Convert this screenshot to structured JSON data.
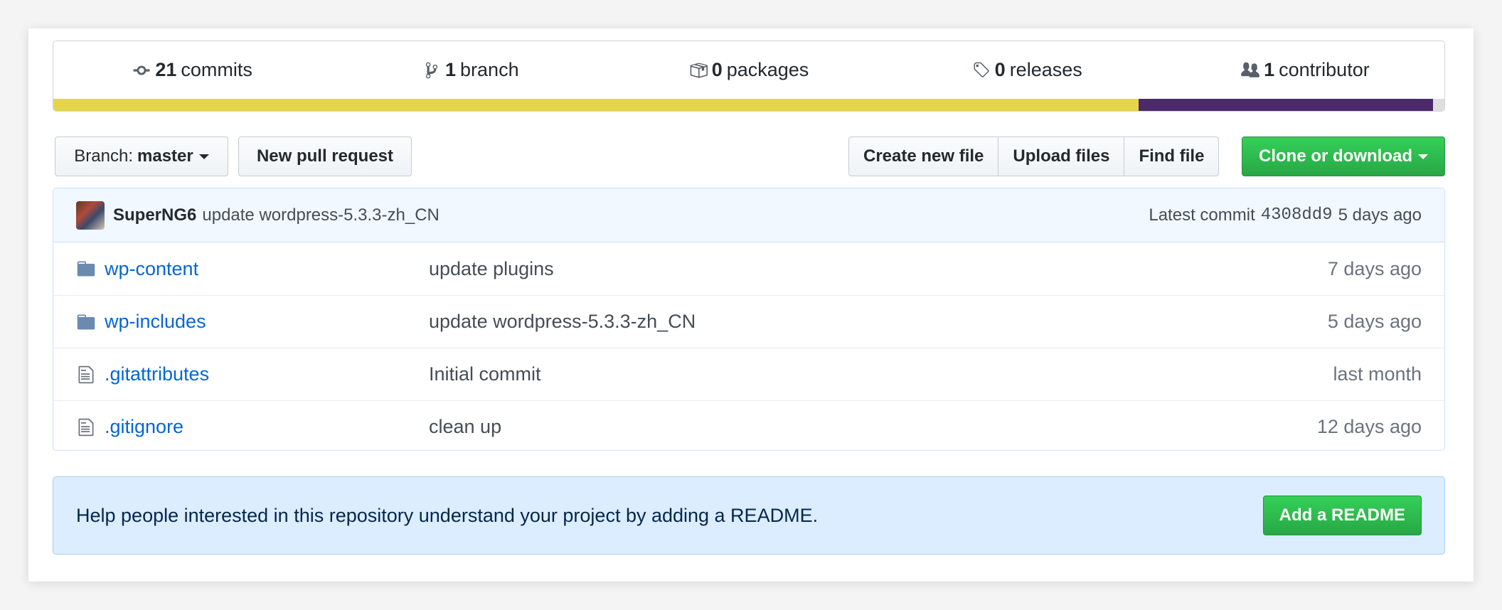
{
  "summary": {
    "commits": {
      "count": "21",
      "label": "commits",
      "icon": "history-icon"
    },
    "branches": {
      "count": "1",
      "label": "branch",
      "icon": "branch-icon"
    },
    "packages": {
      "count": "0",
      "label": "packages",
      "icon": "package-icon"
    },
    "releases": {
      "count": "0",
      "label": "releases",
      "icon": "tag-icon"
    },
    "contributors": {
      "count": "1",
      "label": "contributor",
      "icon": "people-icon"
    }
  },
  "language_bar": {
    "segments": [
      {
        "color": "#e6d54a",
        "fraction": 0.78
      },
      {
        "color": "#4b2a6b",
        "fraction": 0.212
      },
      {
        "color": "#dedede",
        "fraction": 0.008
      }
    ]
  },
  "toolbar": {
    "branch_prefix": "Branch:",
    "branch_name": "master",
    "new_pull_request": "New pull request",
    "create_new_file": "Create new file",
    "upload_files": "Upload files",
    "find_file": "Find file",
    "clone_or_download": "Clone or download"
  },
  "latest_commit": {
    "author": "SuperNG6",
    "message": "update wordpress-5.3.3-zh_CN",
    "label": "Latest commit",
    "sha": "4308dd9",
    "age": "5 days ago"
  },
  "files": [
    {
      "name": "wp-content",
      "type": "folder",
      "message": "update plugins",
      "age": "7 days ago"
    },
    {
      "name": "wp-includes",
      "type": "folder",
      "message": "update wordpress-5.3.3-zh_CN",
      "age": "5 days ago"
    },
    {
      "name": ".gitattributes",
      "type": "file",
      "message": "Initial commit",
      "age": "last month"
    },
    {
      "name": ".gitignore",
      "type": "file",
      "message": "clean up",
      "age": "12 days ago"
    }
  ],
  "readme": {
    "text": "Help people interested in this repository understand your project by adding a README.",
    "button": "Add a README"
  },
  "colors": {
    "green": "#28a745",
    "link": "#0366d6",
    "banner": "#dbedff"
  }
}
